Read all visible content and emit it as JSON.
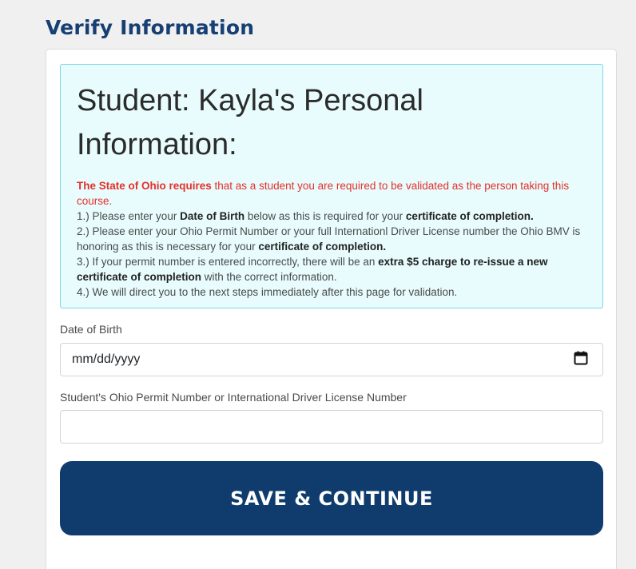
{
  "page": {
    "heading": "Verify Information"
  },
  "info_box": {
    "title_line1": "Student: Kayla's Personal",
    "title_line2": "Information:",
    "state_requirement_bold": "The State of Ohio requires",
    "state_requirement_rest": " that as a student you are required to be validated as the person taking this course.",
    "item1_pre": "1.) Please enter your ",
    "item1_bold1": "Date of Birth",
    "item1_mid": " below as this is required for your ",
    "item1_bold2": "certificate of completion.",
    "item2_pre": "2.) Please enter your Ohio Permit Number or your full Internationl Driver License number the Ohio BMV is honoring as this is necessary for your ",
    "item2_bold": "certificate of completion.",
    "item3_pre": "3.) If your permit number is entered incorrectly, there will be an ",
    "item3_bold": "extra $5 charge to re-issue a new certificate of completion",
    "item3_post": " with the correct information.",
    "item4": "4.) We will direct you to the next steps immediately after this page for validation."
  },
  "form": {
    "dob_label": "Date of Birth",
    "dob_placeholder": "mm/dd/yyyy",
    "permit_label": "Student's Ohio Permit Number or International Driver License Number",
    "permit_value": ""
  },
  "actions": {
    "save_label": "SAVE & CONTINUE"
  },
  "icons": {
    "calendar": "calendar-icon"
  },
  "colors": {
    "heading": "#173f73",
    "button_bg": "#0f3c6c",
    "info_bg": "#e8fcfd",
    "info_border": "#7fd6ea",
    "requirement_red": "#e5302a"
  }
}
